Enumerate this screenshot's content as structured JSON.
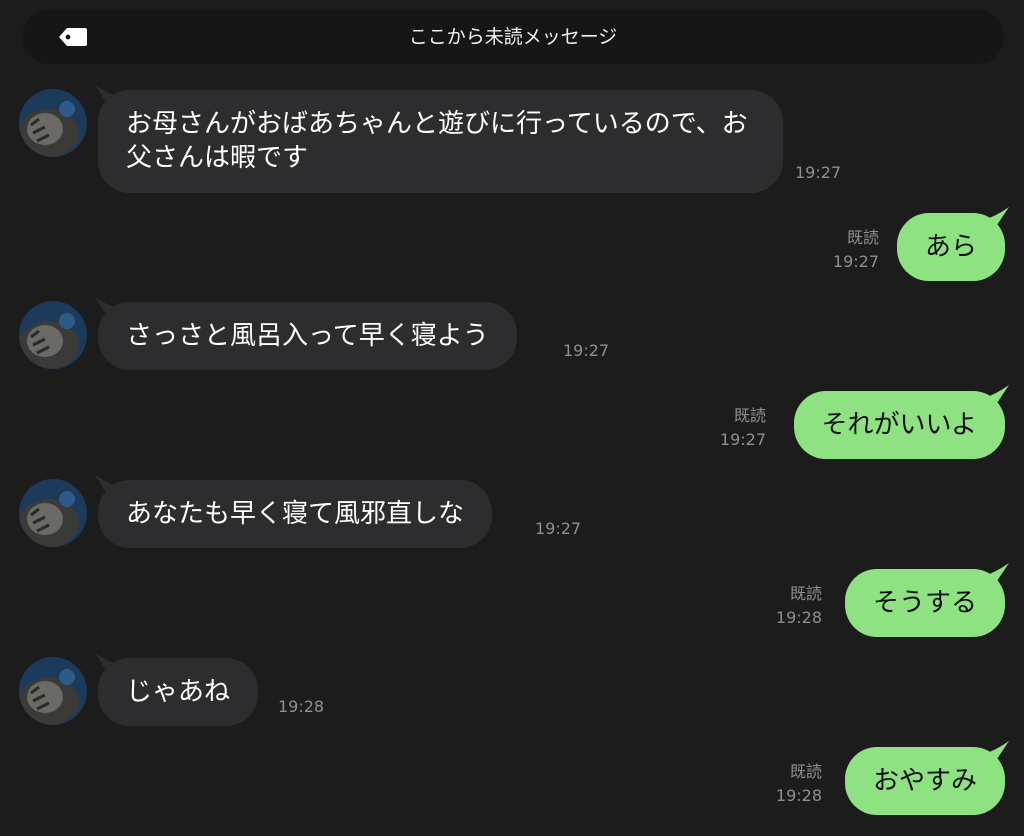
{
  "unread_bar": {
    "label": "ここから未読メッセージ",
    "icon": "tag-icon"
  },
  "colors": {
    "background": "#1c1c1d",
    "incoming_bubble": "#2d2d2f",
    "outgoing_bubble": "#8fe282",
    "meta_text": "#8f8f8f"
  },
  "messages": [
    {
      "direction": "in",
      "text": "お母さんがおばあちゃんと遊びに行っているので、お父さんは暇です",
      "time": "19:27"
    },
    {
      "direction": "out",
      "text": "あら",
      "read": "既読",
      "time": "19:27"
    },
    {
      "direction": "in",
      "text": "さっさと風呂入って早く寝よう",
      "time": "19:27"
    },
    {
      "direction": "out",
      "text": "それがいいよ",
      "read": "既読",
      "time": "19:27"
    },
    {
      "direction": "in",
      "text": "あなたも早く寝て風邪直しな",
      "time": "19:27"
    },
    {
      "direction": "out",
      "text": "そうする",
      "read": "既読",
      "time": "19:28"
    },
    {
      "direction": "in",
      "text": "じゃあね",
      "time": "19:28"
    },
    {
      "direction": "out",
      "text": "おやすみ",
      "read": "既読",
      "time": "19:28"
    }
  ]
}
